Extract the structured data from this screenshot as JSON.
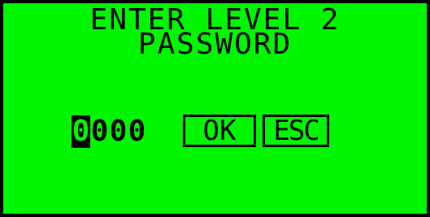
{
  "dialog": {
    "title_line_1": "ENTER LEVEL 2",
    "title_line_2": "PASSWORD"
  },
  "password": {
    "digits": [
      "0",
      "0",
      "0",
      "0"
    ],
    "cursor_index": 0
  },
  "buttons": {
    "ok_label": "OK",
    "esc_label": "ESC"
  },
  "colors": {
    "screen_background": "#00f500",
    "foreground": "#000000"
  }
}
